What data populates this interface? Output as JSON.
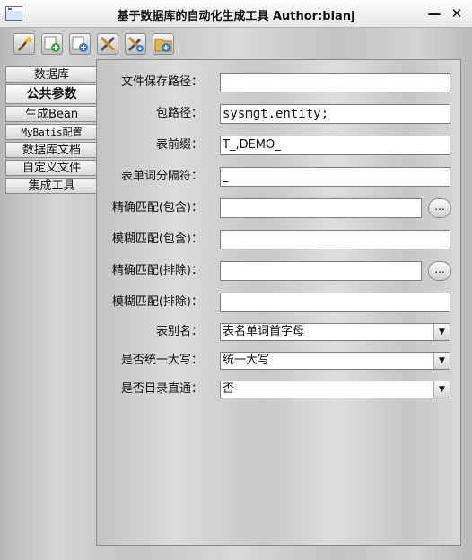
{
  "window": {
    "title": "基于数据库的自动化生成工具 Author:bianj",
    "minimize": "—",
    "close": "✕"
  },
  "toolbar": {
    "icons": [
      "magic-wand-icon",
      "add-new-icon",
      "add-page-icon",
      "tools-icon",
      "settings-add-icon",
      "folder-download-icon"
    ]
  },
  "tabs": [
    {
      "label": "数据库"
    },
    {
      "label": "公共参数"
    },
    {
      "label": "生成Bean"
    },
    {
      "label": "MyBatis配置"
    },
    {
      "label": "数据库文档"
    },
    {
      "label": "自定义文件"
    },
    {
      "label": "集成工具"
    }
  ],
  "form": {
    "save_path": {
      "label": "文件保存路径：",
      "value": ""
    },
    "package_path": {
      "label": "包路径：",
      "value": "sysmgt.entity;"
    },
    "table_prefix": {
      "label": "表前缀：",
      "value": "T_,DEMO_"
    },
    "word_separator": {
      "label": "表单词分隔符：",
      "value": "_"
    },
    "exact_include": {
      "label": "精确匹配(包含)：",
      "value": "",
      "button": "..."
    },
    "fuzzy_include": {
      "label": "模糊匹配(包含)：",
      "value": ""
    },
    "exact_exclude": {
      "label": "精确匹配(排除)：",
      "value": "",
      "button": "..."
    },
    "fuzzy_exclude": {
      "label": "模糊匹配(排除)：",
      "value": ""
    },
    "table_alias": {
      "label": "表别名：",
      "value": "表名单词首字母"
    },
    "uppercase": {
      "label": "是否统一大写：",
      "value": "统一大写"
    },
    "dir_direct": {
      "label": "是否目录直通：",
      "value": "否"
    }
  }
}
